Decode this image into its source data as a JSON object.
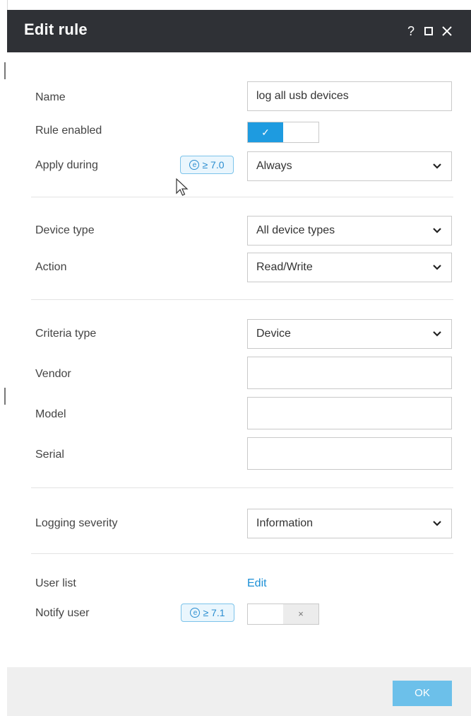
{
  "dialog": {
    "title": "Edit rule",
    "controls": {
      "help": "?"
    }
  },
  "general": {
    "name_label": "Name",
    "name_value": "log all usb devices",
    "rule_enabled_label": "Rule enabled",
    "rule_enabled": true,
    "toggle_on_glyph": "✓",
    "apply_during_label": "Apply during",
    "apply_during_version": "≥ 7.0",
    "apply_during_value": "Always"
  },
  "device": {
    "device_type_label": "Device type",
    "device_type_value": "All device types",
    "action_label": "Action",
    "action_value": "Read/Write"
  },
  "criteria": {
    "criteria_type_label": "Criteria type",
    "criteria_type_value": "Device",
    "vendor_label": "Vendor",
    "vendor_value": "",
    "model_label": "Model",
    "model_value": "",
    "serial_label": "Serial",
    "serial_value": ""
  },
  "logging": {
    "severity_label": "Logging severity",
    "severity_value": "Information"
  },
  "users": {
    "user_list_label": "User list",
    "user_list_link": "Edit",
    "notify_user_label": "Notify user",
    "notify_user_version": "≥ 7.1",
    "notify_user_enabled": false,
    "toggle_off_glyph": "×"
  },
  "footer": {
    "ok_label": "OK"
  },
  "colors": {
    "titlebar": "#2f3136",
    "accent": "#1e9be0",
    "link": "#1b8fd6",
    "ok_button": "#6cc0ea"
  },
  "badge_icon_glyph": "e"
}
